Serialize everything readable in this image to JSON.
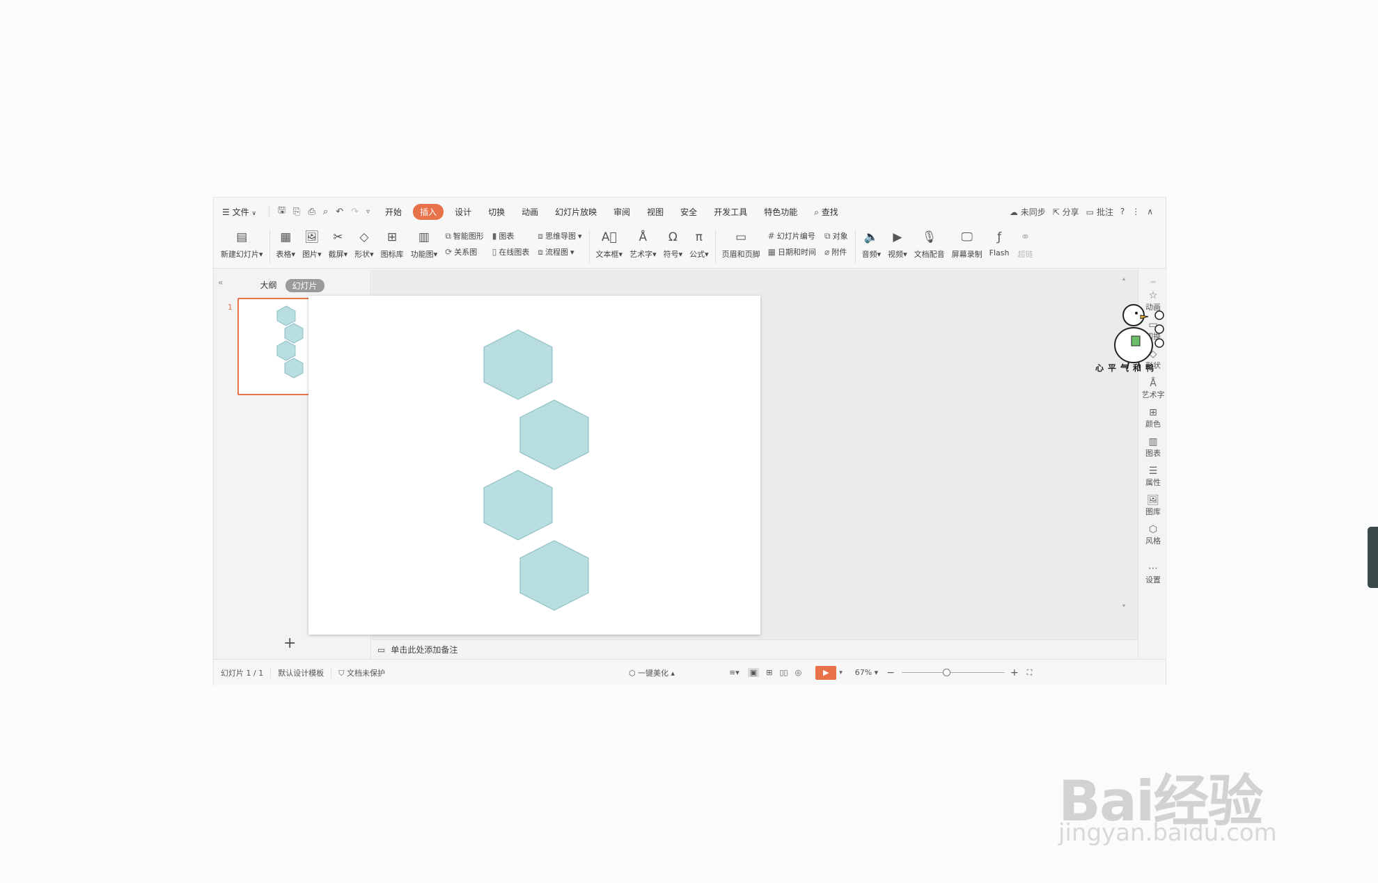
{
  "menubar": {
    "file": "文件",
    "tabs": [
      "开始",
      "插入",
      "设计",
      "切换",
      "动画",
      "幻灯片放映",
      "审阅",
      "视图",
      "安全",
      "开发工具",
      "特色功能"
    ],
    "active_tab": "插入",
    "search": "查找",
    "sync": "未同步",
    "share": "分享",
    "comment": "批注",
    "help": "?"
  },
  "ribbon": {
    "new_slide": "新建幻灯片",
    "table": "表格",
    "picture": "图片",
    "screenshot": "截屏",
    "shape": "形状",
    "icon_lib": "图标库",
    "function_chart": "功能图",
    "smart_graphic": "智能图形",
    "chart": "图表",
    "relation_chart": "关系图",
    "online_chart": "在线图表",
    "mindmap": "思维导图",
    "flowchart": "流程图",
    "textbox": "文本框",
    "wordart": "艺术字",
    "symbol": "符号",
    "formula": "公式",
    "header_footer": "页眉和页脚",
    "slide_number": "幻灯片编号",
    "object": "对象",
    "datetime": "日期和时间",
    "attachment": "附件",
    "audio": "音频",
    "video": "视频",
    "doc_dubbing": "文档配音",
    "screen_record": "屏幕录制",
    "flash": "Flash",
    "hyperlink": "超链"
  },
  "left_panel": {
    "outline_tab": "大纲",
    "slides_tab": "幻灯片",
    "slide_number": "1"
  },
  "notes_placeholder": "单击此处添加备注",
  "sidebar": {
    "animation": "动画",
    "transition": "切换",
    "shape": "形状",
    "wordart": "艺术字",
    "color": "颜色",
    "chart": "图表",
    "property": "属性",
    "gallery": "图库",
    "style": "风格",
    "settings": "设置"
  },
  "status": {
    "slide_info": "幻灯片 1 / 1",
    "template": "默认设计模板",
    "protection": "文档未保护",
    "beautify": "一键美化",
    "zoom": "67%",
    "zoom_level": 0.43
  },
  "overlay": {
    "duck_caption": "心平气和鸭"
  },
  "watermark": {
    "brand": "Bai经验",
    "url": "jingyan.baidu.com"
  },
  "colors": {
    "accent": "#e8724a",
    "hexagon_fill": "#b9dee1",
    "hexagon_stroke": "#8fbfc4"
  },
  "slide": {
    "shape_count": 4,
    "shape_type": "hexagon"
  }
}
